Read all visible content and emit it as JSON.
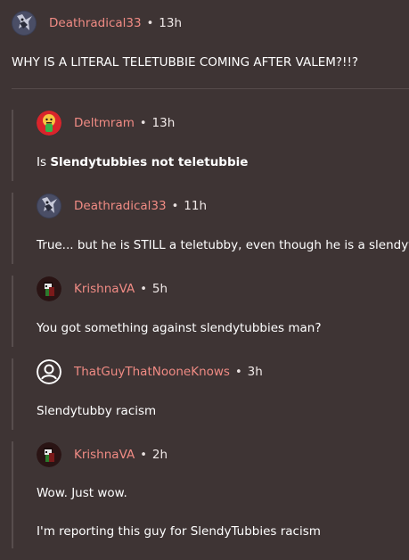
{
  "comments": [
    {
      "author": "Deathradical33",
      "time": "13h",
      "text": "WHY IS A LITERAL TELETUBBIE COMING AFTER VALEM?!!?",
      "avatar_icon": "creature-avatar-icon"
    },
    {
      "author": "Deltmram",
      "time": "13h",
      "text_prefix": "Is ",
      "text_bold": "Slendytubbies not teletubbie",
      "avatar_icon": "character-avatar-icon"
    },
    {
      "author": "Deathradical33",
      "time": "11h",
      "text": "True... but he is STILL a teletubby, even though he is a slendytubb",
      "avatar_icon": "creature-avatar-icon"
    },
    {
      "author": "KrishnaVA",
      "time": "5h",
      "text": "You got something against slendytubbies man?",
      "avatar_icon": "pixel-avatar-icon"
    },
    {
      "author": "ThatGuyThatNooneKnows",
      "time": "3h",
      "text": "Slendytubby racism",
      "avatar_icon": "default-user-icon"
    },
    {
      "author": "KrishnaVA",
      "time": "2h",
      "text": "Wow. Just wow.",
      "text2": "I'm reporting this guy for SlendyTubbies racism",
      "avatar_icon": "pixel-avatar-icon"
    }
  ],
  "separator": "•",
  "colors": {
    "background": "#3e3434",
    "author": "#f08b84",
    "thread_line": "#574d4d"
  }
}
